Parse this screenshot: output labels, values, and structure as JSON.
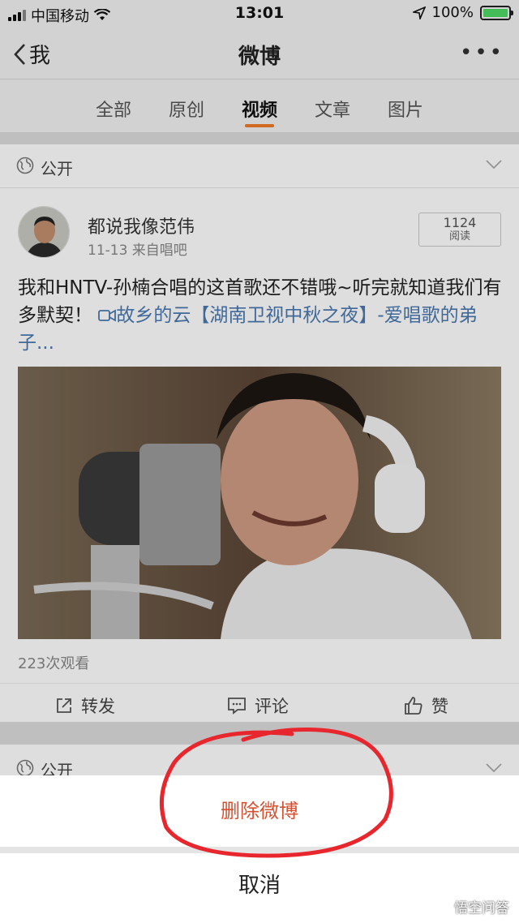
{
  "status_bar": {
    "carrier": "中国移动",
    "time": "13:01",
    "battery": "100%"
  },
  "nav": {
    "back_label": "我",
    "title": "微博",
    "more_icon": "more-icon"
  },
  "tabs": [
    {
      "label": "全部"
    },
    {
      "label": "原创"
    },
    {
      "label": "视频",
      "active": true
    },
    {
      "label": "文章"
    },
    {
      "label": "图片"
    }
  ],
  "post": {
    "visibility": "公开",
    "username": "都说我像范伟",
    "meta": "11-13  来自唱吧",
    "reads_count": "1124",
    "reads_label": "阅读",
    "text": "我和HNTV-孙楠合唱的这首歌还不错哦~听完就知道我们有多默契！ ",
    "link_text": "故乡的云【湖南卫视中秋之夜】-爱唱歌的弟子...",
    "views": "223次观看",
    "actions": {
      "repost": "转发",
      "comment": "评论",
      "like": "赞"
    }
  },
  "second_post": {
    "visibility": "公开"
  },
  "action_sheet": {
    "delete_label": "删除微博",
    "cancel_label": "取消"
  },
  "watermark": "悟空问答",
  "colors": {
    "accent": "#ef7a26",
    "link": "#4a79b0",
    "destructive": "#d9502f",
    "annotation": "#e8262d"
  }
}
